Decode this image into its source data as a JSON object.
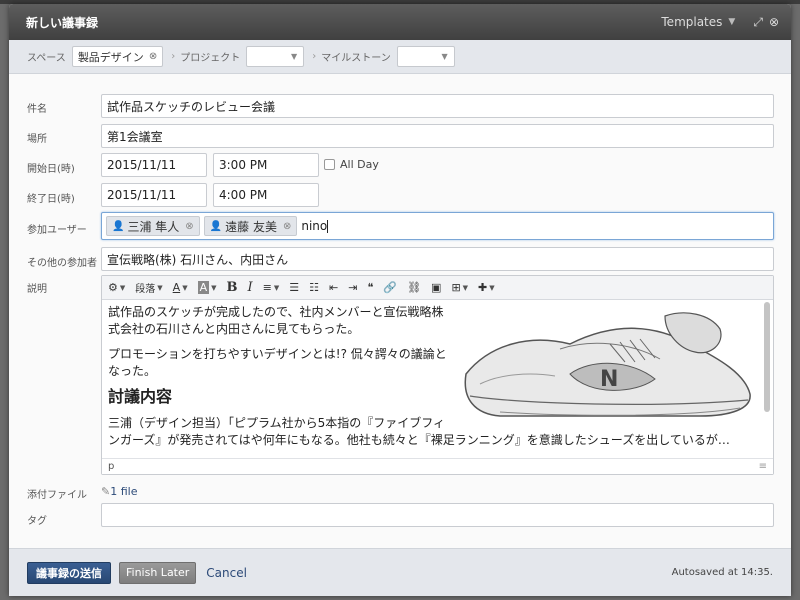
{
  "dialog": {
    "title": "新しい議事録",
    "templates_label": "Templates"
  },
  "scope": {
    "space_label": "スペース",
    "space_value": "製品デザイン",
    "project_label": "プロジェクト",
    "milestone_label": "マイルストーン"
  },
  "form": {
    "subject_label": "件名",
    "subject_value": "試作品スケッチのレビュー会議",
    "place_label": "場所",
    "place_value": "第1会議室",
    "start_label": "開始日(時)",
    "start_date": "2015/11/11",
    "start_time": "3:00 PM",
    "allday_label": "All Day",
    "end_label": "終了日(時)",
    "end_date": "2015/11/11",
    "end_time": "4:00 PM",
    "participants_label": "参加ユーザー",
    "participants": [
      "三浦 隼人",
      "遠藤 友美"
    ],
    "participants_typed": "nino",
    "others_label": "その他の参加者",
    "others_value": "宣伝戦略(株) 石川さん、内田さん",
    "description_label": "説明",
    "attachments_label": "添付ファイル",
    "attachments_value": "1 file",
    "tags_label": "タグ"
  },
  "editor": {
    "toolbar": {
      "paragraph_label": "段落",
      "bold": "B",
      "italic": "I"
    },
    "paragraph1": "試作品のスケッチが完成したので、社内メンバーと宣伝戦略株式会社の石川さんと内田さんに見てもらった。",
    "paragraph2": "プロモーションを打ちやすいデザインとは!? 侃々諤々の議論となった。",
    "heading": "討議内容",
    "paragraph3": "三浦（デザイン担当）「ピプラム社から5本指の『ファイブフィンガーズ』が発売されてはや何年にもなる。他社も続々と『裸足ランニング』を意識したシューズを出しているが…",
    "status_path": "p",
    "image_letter": "N"
  },
  "footer": {
    "submit_label": "議事録の送信",
    "finish_later_label": "Finish Later",
    "cancel_label": "Cancel",
    "autosave_text": "Autosaved at 14:35."
  },
  "colors": {
    "primary_button": "#2d4f80",
    "link": "#2c4a78",
    "focus_border": "#7aa6d6"
  }
}
